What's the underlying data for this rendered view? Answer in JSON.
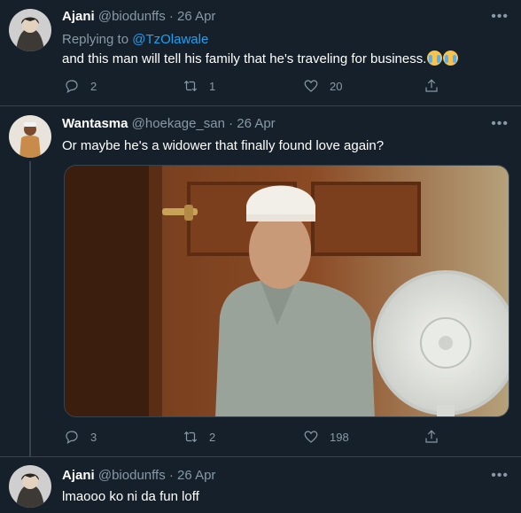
{
  "tweets": [
    {
      "name": "Ajani",
      "handle": "@biodunffs",
      "date": "26 Apr",
      "replying_label": "Replying to ",
      "replying_handle": "@TzOlawale",
      "text": "and this man will tell his family that he's traveling for business.",
      "emoji": [
        "loudly-crying-face-emoji",
        "loudly-crying-face-emoji"
      ],
      "replies": "2",
      "retweets": "1",
      "likes": "20"
    },
    {
      "name": "Wantasma",
      "handle": "@hoekage_san",
      "date": "26 Apr",
      "text": "Or maybe he's a widower that finally found love again?",
      "replies": "3",
      "retweets": "2",
      "likes": "198"
    },
    {
      "name": "Ajani",
      "handle": "@biodunffs",
      "date": "26 Apr",
      "text": "lmaooo ko ni da fun loff"
    }
  ],
  "separator": " · ",
  "more_label": "•••",
  "colors": {
    "background": "#15202b",
    "muted": "#8899a6",
    "link": "#1da1f2",
    "divider": "#38444d"
  }
}
